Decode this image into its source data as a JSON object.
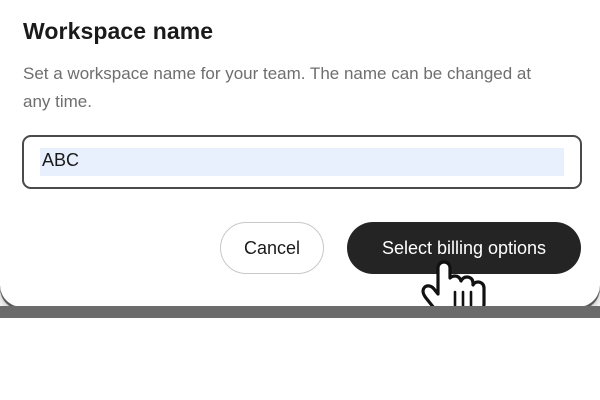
{
  "dialog": {
    "title": "Workspace name",
    "description": "Set a workspace name for your team. The name can be changed at any time.",
    "input": {
      "value": "ABC"
    },
    "buttons": {
      "cancel_label": "Cancel",
      "primary_label": "Select billing options"
    }
  },
  "colors": {
    "primary_button_bg": "#242424",
    "input_border": "#4a4a4a",
    "selection_highlight": "#e8effd",
    "description_text": "#6e6e6e"
  },
  "icons": {
    "cursor": "hand-pointer-icon"
  }
}
